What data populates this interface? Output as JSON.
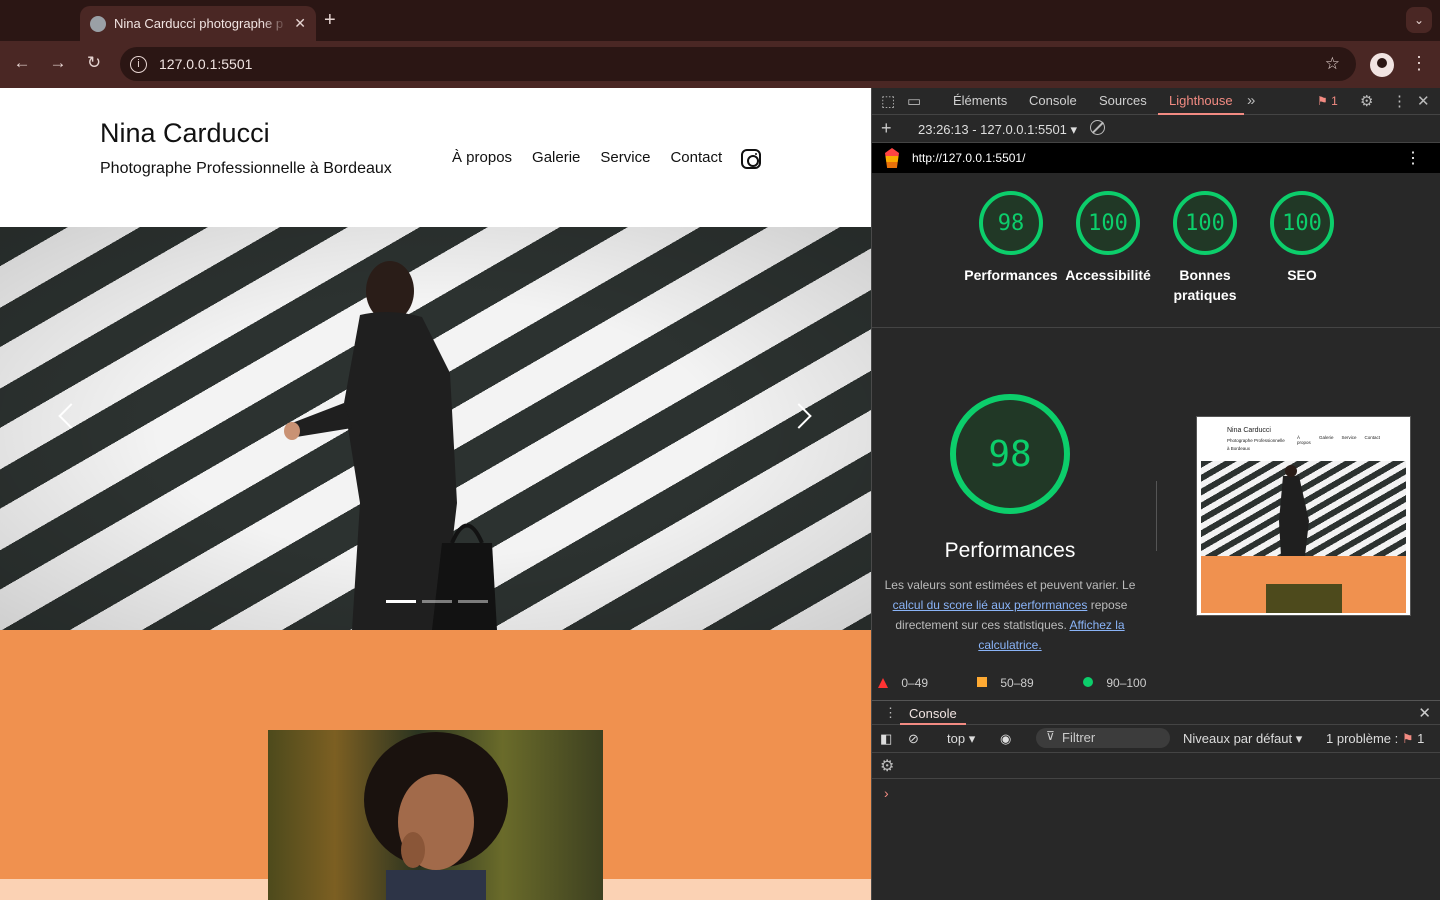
{
  "browser": {
    "tab_title": "Nina Carducci photographe p",
    "url": "127.0.0.1:5501"
  },
  "site": {
    "name": "Nina Carducci",
    "subtitle": "Photographe Professionnelle à Bordeaux",
    "nav": [
      "À propos",
      "Galerie",
      "Service",
      "Contact"
    ]
  },
  "devtools": {
    "tabs": [
      "Éléments",
      "Console",
      "Sources",
      "Lighthouse"
    ],
    "active_tab": "Lighthouse",
    "issue_count": "1",
    "report_select": "23:26:13 - 127.0.0.1:5501",
    "report_url": "http://127.0.0.1:5501/",
    "scores": [
      {
        "value": "98",
        "label": "Performances"
      },
      {
        "value": "100",
        "label": "Accessibilité"
      },
      {
        "value": "100",
        "label": "Bonnes pratiques"
      },
      {
        "value": "100",
        "label": "SEO"
      }
    ],
    "main_score": "98",
    "main_title": "Performances",
    "desc_part1": "Les valeurs sont estimées et peuvent varier. Le",
    "desc_link1": "calcul du score lié aux performances",
    "desc_part2": "repose directement sur ces statistiques.",
    "desc_link2": "Affichez la calculatrice.",
    "legend": [
      "0–49",
      "50–89",
      "90–100"
    ],
    "thumb_name": "Nina Carducci",
    "thumb_sub": "Photographe Professionnelle à Bordeaux",
    "thumb_nav": [
      "À propos",
      "Galerie",
      "Service",
      "Contact"
    ]
  },
  "console": {
    "title": "Console",
    "context": "top",
    "filter_placeholder": "Filtrer",
    "levels": "Niveaux par défaut",
    "problems_label": "1 problème :",
    "problems_count": "1"
  },
  "colors": {
    "score_green": "#0cce6b",
    "accent_orange": "#f0914f",
    "devtools_accent": "#f28b82"
  }
}
